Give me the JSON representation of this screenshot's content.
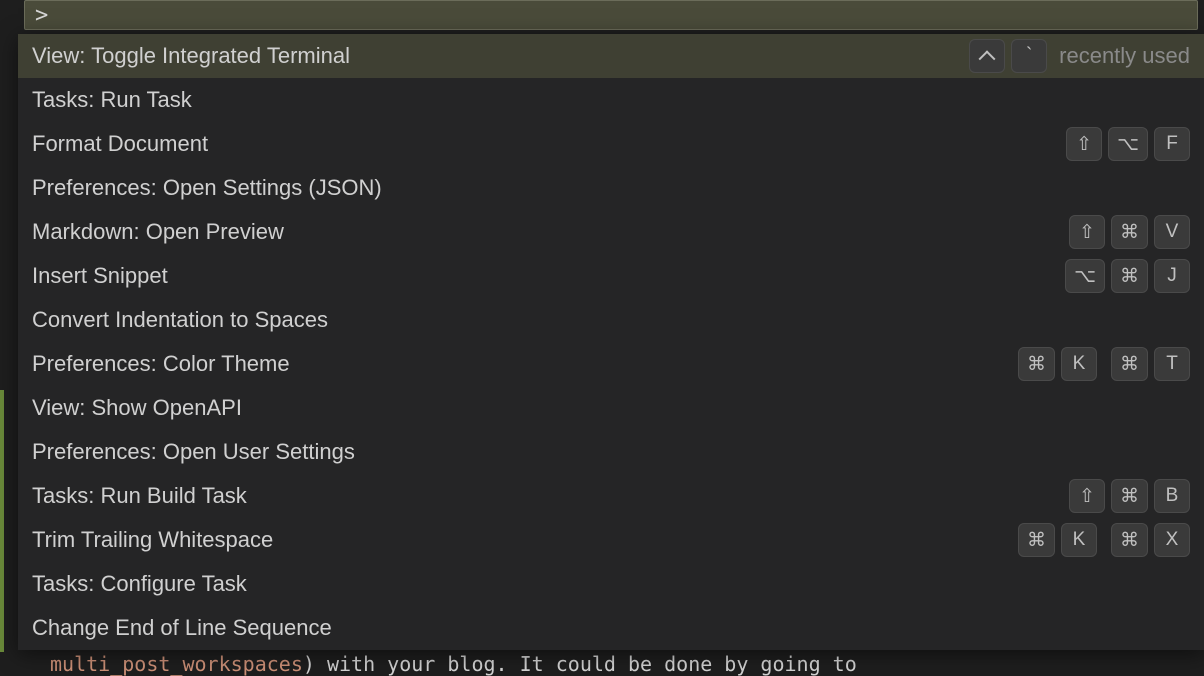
{
  "input": {
    "prefix": ">"
  },
  "firstRow": {
    "label": "View: Toggle Integrated Terminal",
    "hint": "recently used",
    "toggleKey": "`"
  },
  "commands": [
    {
      "label": "View: Toggle Integrated Terminal",
      "selected": true,
      "special": "first"
    },
    {
      "label": "Tasks: Run Task"
    },
    {
      "label": "Format Document",
      "keys": [
        [
          "⇧",
          "⌥",
          "F"
        ]
      ]
    },
    {
      "label": "Preferences: Open Settings (JSON)"
    },
    {
      "label": "Markdown: Open Preview",
      "keys": [
        [
          "⇧",
          "⌘",
          "V"
        ]
      ]
    },
    {
      "label": "Insert Snippet",
      "keys": [
        [
          "⌥",
          "⌘",
          "J"
        ]
      ]
    },
    {
      "label": "Convert Indentation to Spaces"
    },
    {
      "label": "Preferences: Color Theme",
      "keys": [
        [
          "⌘",
          "K"
        ],
        [
          "⌘",
          "T"
        ]
      ]
    },
    {
      "label": "View: Show OpenAPI"
    },
    {
      "label": "Preferences: Open User Settings"
    },
    {
      "label": "Tasks: Run Build Task",
      "keys": [
        [
          "⇧",
          "⌘",
          "B"
        ]
      ]
    },
    {
      "label": "Trim Trailing Whitespace",
      "keys": [
        [
          "⌘",
          "K"
        ],
        [
          "⌘",
          "X"
        ]
      ]
    },
    {
      "label": "Tasks: Configure Task"
    },
    {
      "label": "Change End of Line Sequence"
    }
  ],
  "underlay": ") with your blog. It could be done by going to"
}
